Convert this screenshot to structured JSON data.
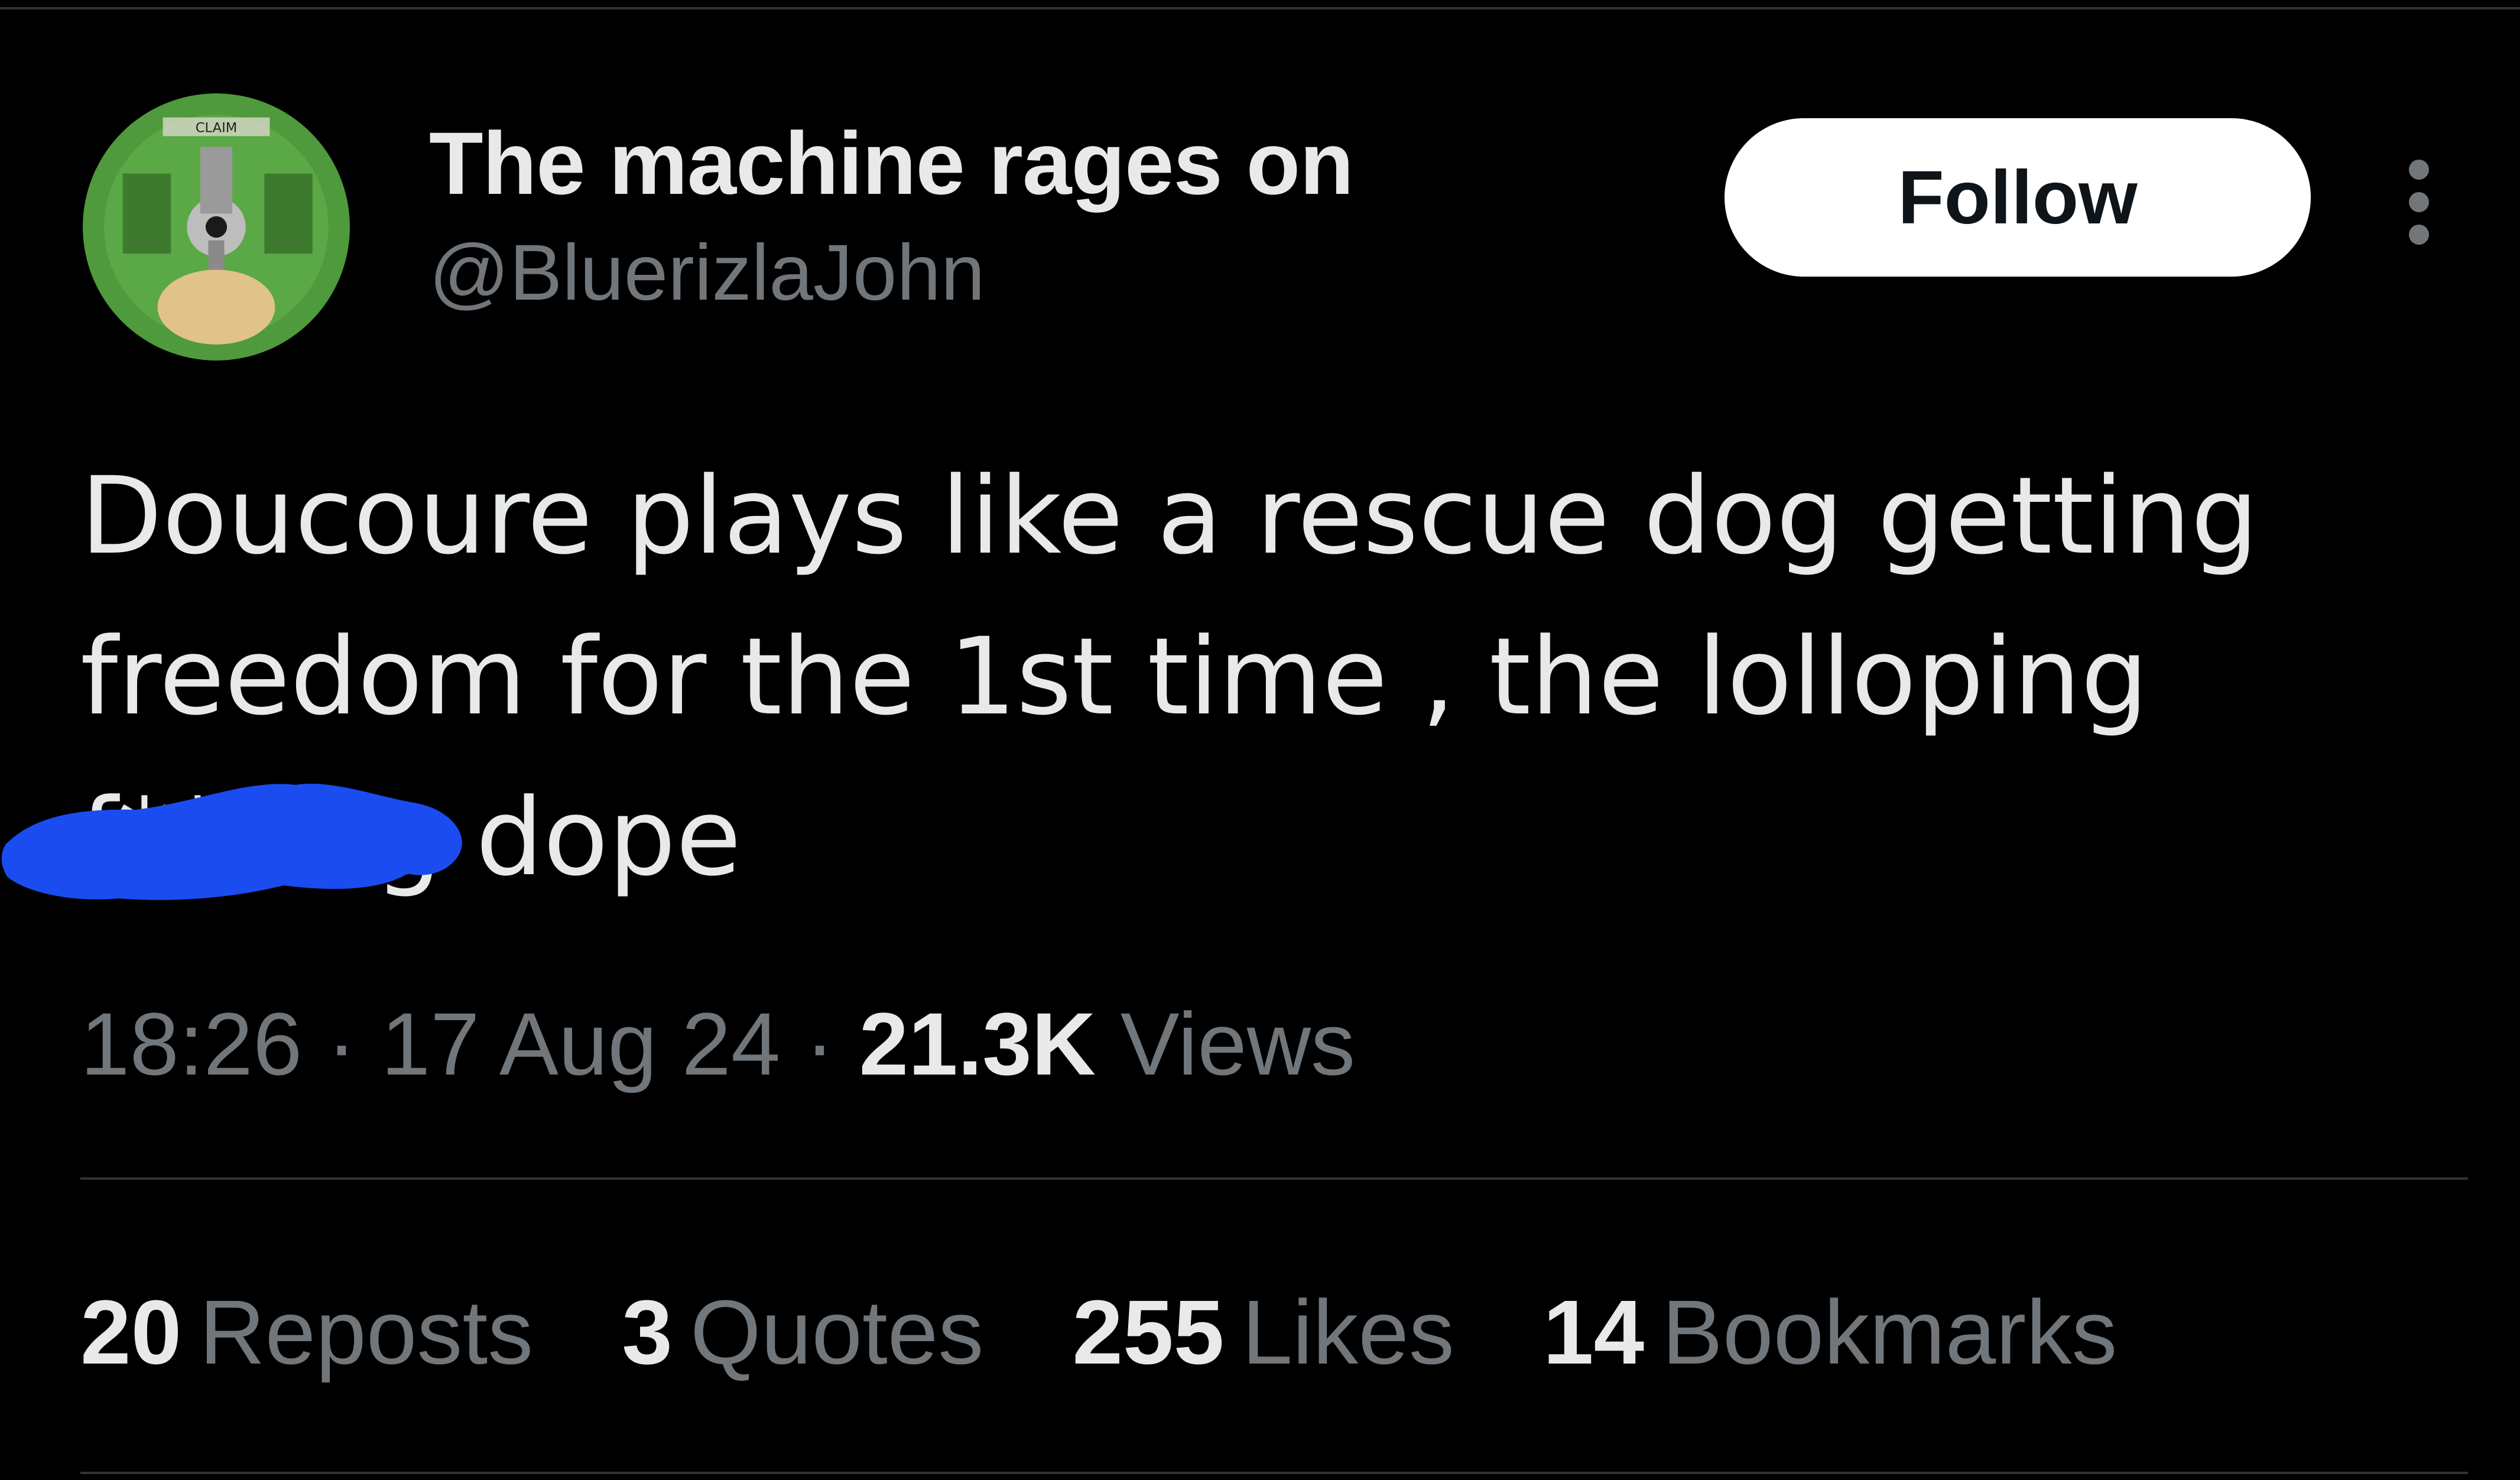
{
  "author": {
    "display_name": "The machine rages on",
    "handle": "@BluerizlaJohn",
    "avatar_label": "CLAIM"
  },
  "follow_label": "Follow",
  "tweet": {
    "lines": [
      "Doucoure plays like a rescue dog getting",
      "freedom for the 1st time , the lolloping",
      "f***ing dope"
    ]
  },
  "meta": {
    "time": "18:26",
    "date": "17 Aug 24",
    "views_count": "21.3K",
    "views_label": "Views",
    "separator": "·"
  },
  "stats": [
    {
      "count": "20",
      "label": "Reposts"
    },
    {
      "count": "3",
      "label": "Quotes"
    },
    {
      "count": "255",
      "label": "Likes"
    },
    {
      "count": "14",
      "label": "Bookmarks"
    }
  ],
  "colors": {
    "background": "#000000",
    "primary_text": "#e7e9ea",
    "secondary_text": "#71767b",
    "follow_bg": "#ffffff",
    "redaction": "#1a4cf0"
  },
  "icons": {
    "more": "more-horizontal-icon"
  }
}
